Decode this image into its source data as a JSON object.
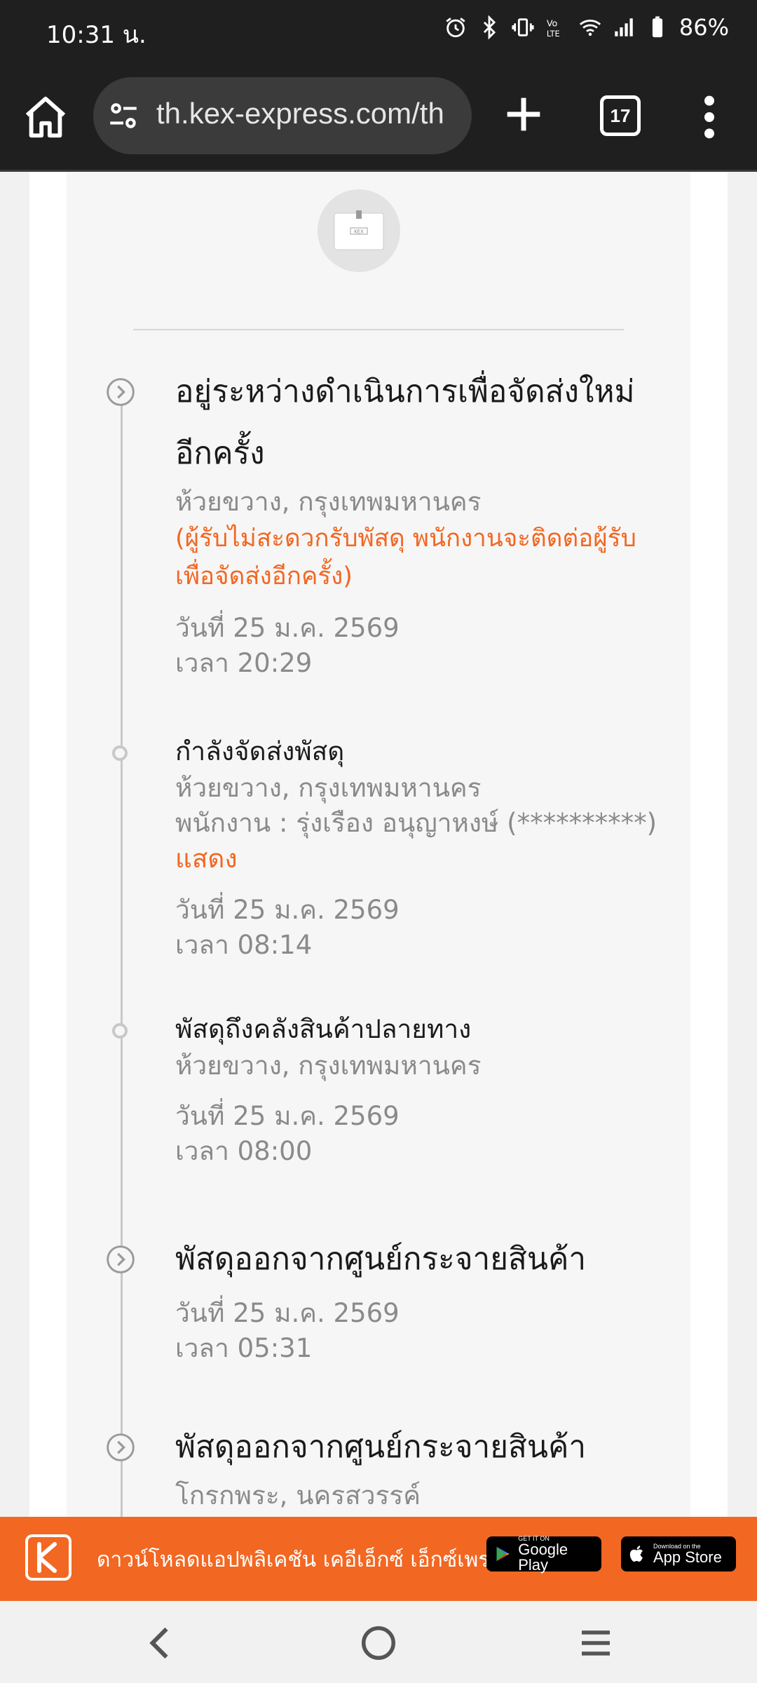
{
  "status_bar": {
    "time": "10:31 น.",
    "battery": "86%",
    "icons": [
      "alarm-icon",
      "bluetooth-icon",
      "vibrate-icon",
      "volte-icon",
      "wifi-icon",
      "signal-icon",
      "battery-icon"
    ]
  },
  "browser": {
    "url": "th.kex-express.com/th",
    "tab_count": "17"
  },
  "package_logo_text": "KEX",
  "timeline": [
    {
      "title": "อยู่ระหว่างดำเนินการเพื่อจัดส่งใหม่อีกครั้ง",
      "location": "ห้วยขวาง, กรุงเทพมหานคร",
      "note": "(ผู้รับไม่สะดวกรับพัสดุ พนักงานจะติดต่อผู้รับเพื่อจัดส่งอีกครั้ง)",
      "date": "วันที่ 25 ม.ค. 2569",
      "time": "เวลา 20:29",
      "icon": "chevron-circle-icon"
    },
    {
      "title": "กำลังจัดส่งพัสดุ",
      "location": "ห้วยขวาง, กรุงเทพมหานคร",
      "staff": "พนักงาน : รุ่งเรือง อนุญาหงษ์ (**********)",
      "show_label": "แสดง",
      "date": "วันที่ 25 ม.ค. 2569",
      "time": "เวลา 08:14",
      "icon": "dot-icon"
    },
    {
      "title": "พัสดุถึงคลังสินค้าปลายทาง",
      "location": "ห้วยขวาง, กรุงเทพมหานคร",
      "date": "วันที่ 25 ม.ค. 2569",
      "time": "เวลา 08:00",
      "icon": "dot-icon"
    },
    {
      "title": "พัสดุออกจากศูนย์กระจายสินค้า",
      "date": "วันที่ 25 ม.ค. 2569",
      "time": "เวลา 05:31",
      "icon": "chevron-circle-icon"
    },
    {
      "title": "พัสดุออกจากศูนย์กระจายสินค้า",
      "location": "โกรกพระ, นครสวรรค์",
      "icon": "chevron-circle-icon"
    }
  ],
  "app_banner": {
    "text": "ดาวน์โหลดแอปพลิเคชัน เคอีเอ็กซ์ เอ็กซ์เพรส",
    "google_play_small": "GET IT ON",
    "google_play_big": "Google Play",
    "app_store_small": "Download on the",
    "app_store_big": "App Store",
    "accent_color": "#f26722"
  },
  "nav": {
    "buttons": [
      "back-icon",
      "home-icon",
      "recents-icon"
    ]
  }
}
